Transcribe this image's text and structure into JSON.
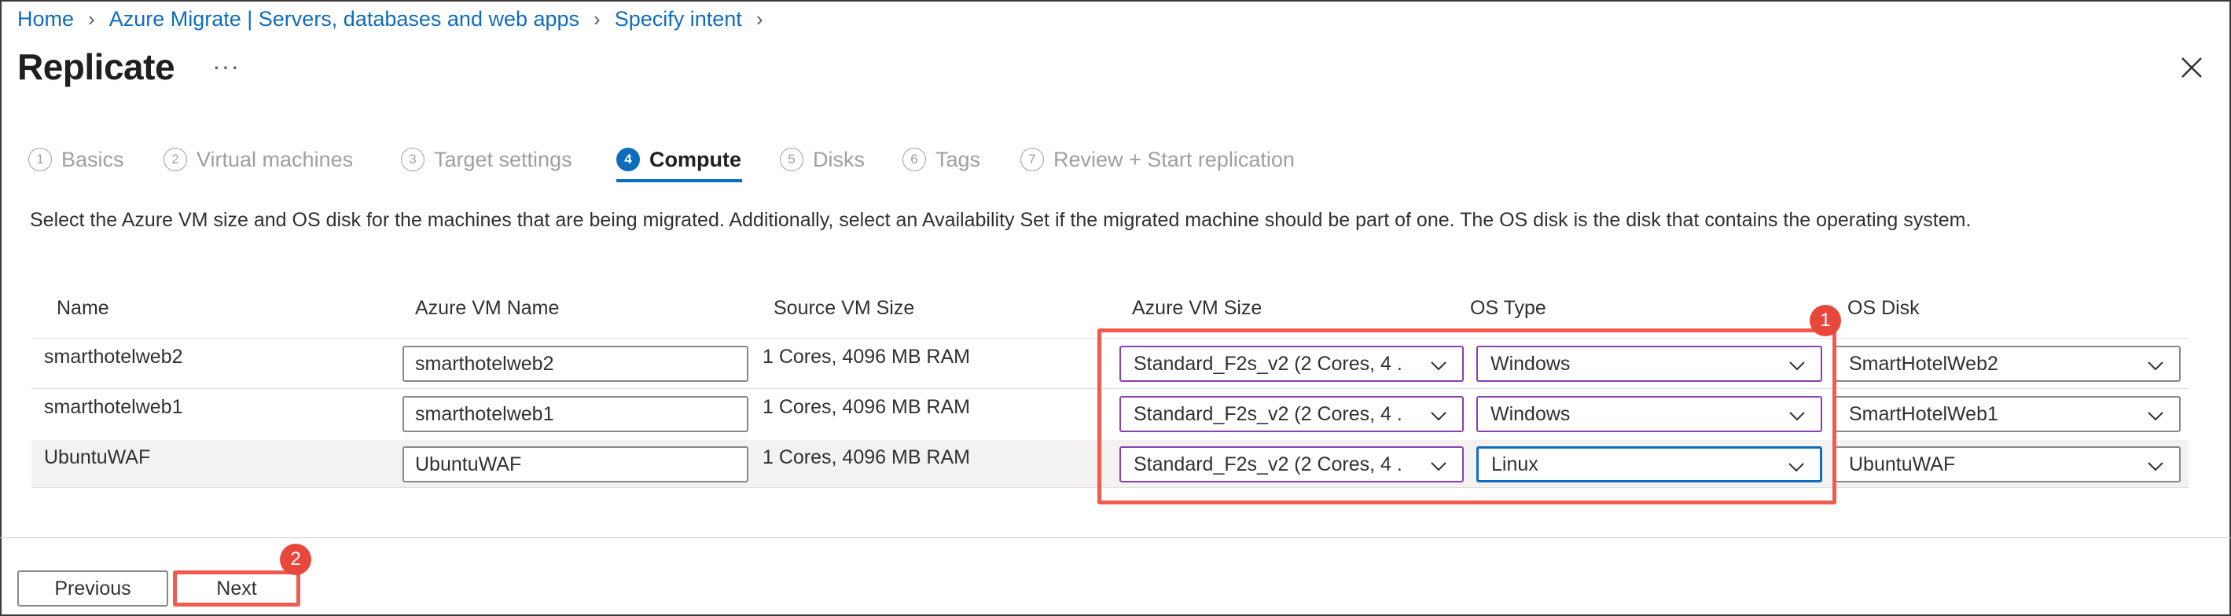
{
  "breadcrumb": {
    "items": [
      "Home",
      "Azure Migrate | Servers, databases and web apps",
      "Specify intent"
    ]
  },
  "header": {
    "title": "Replicate",
    "more_label": "···"
  },
  "wizard": {
    "steps": [
      {
        "num": "1",
        "label": "Basics"
      },
      {
        "num": "2",
        "label": "Virtual machines"
      },
      {
        "num": "3",
        "label": "Target settings"
      },
      {
        "num": "4",
        "label": "Compute"
      },
      {
        "num": "5",
        "label": "Disks"
      },
      {
        "num": "6",
        "label": "Tags"
      },
      {
        "num": "7",
        "label": "Review + Start replication"
      }
    ],
    "active_step": "Compute"
  },
  "description": "Select the Azure VM size and OS disk for the machines that are being migrated. Additionally, select an Availability Set if the migrated machine should be part of one. The OS disk is the disk that contains the operating system.",
  "table": {
    "columns": [
      "Name",
      "Azure VM Name",
      "Source VM Size",
      "Azure VM Size",
      "OS Type",
      "OS Disk"
    ],
    "rows": [
      {
        "name": "smarthotelweb2",
        "azure_vm_name": "smarthotelweb2",
        "source_vm_size": "1 Cores, 4096 MB RAM",
        "azure_vm_size": "Standard_F2s_v2 (2 Cores, 4 ...",
        "os_type": "Windows",
        "os_disk": "SmartHotelWeb2"
      },
      {
        "name": "smarthotelweb1",
        "azure_vm_name": "smarthotelweb1",
        "source_vm_size": "1 Cores, 4096 MB RAM",
        "azure_vm_size": "Standard_F2s_v2 (2 Cores, 4 ...",
        "os_type": "Windows",
        "os_disk": "SmartHotelWeb1"
      },
      {
        "name": "UbuntuWAF",
        "azure_vm_name": "UbuntuWAF",
        "source_vm_size": "1 Cores, 4096 MB RAM",
        "azure_vm_size": "Standard_F2s_v2 (2 Cores, 4 ...",
        "os_type": "Linux",
        "os_disk": "UbuntuWAF"
      }
    ]
  },
  "annotations": {
    "badge_1": "1",
    "badge_2": "2",
    "highlight_color": "#f05a4f"
  },
  "footer": {
    "previous_label": "Previous",
    "next_label": "Next"
  },
  "colors": {
    "accent": "#0f6cbd",
    "dropdown_border_purple": "#8a3fb0"
  }
}
